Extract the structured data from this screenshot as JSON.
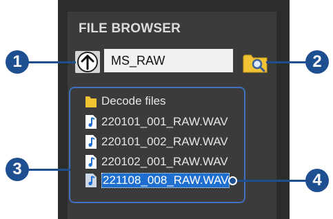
{
  "browser": {
    "title": "FILE BROWSER",
    "path_value": "MS_RAW",
    "up_icon": "up-arrow-icon",
    "browse_icon": "folder-search-icon",
    "items": [
      {
        "label": "Decode files",
        "type": "folder",
        "icon": "folder-icon"
      },
      {
        "label": "220101_001_RAW.WAV",
        "type": "audio",
        "icon": "audio-file-icon"
      },
      {
        "label": "220101_002_RAW.WAV",
        "type": "audio",
        "icon": "audio-file-icon"
      },
      {
        "label": "220102_001_RAW.WAV",
        "type": "audio",
        "icon": "audio-file-icon"
      },
      {
        "label": "221108_008_RAW.WAV",
        "type": "audio",
        "icon": "audio-file-icon",
        "selected": true
      }
    ]
  },
  "callouts": [
    "1",
    "2",
    "3",
    "4"
  ],
  "colors": {
    "panel": "#2c2c2c",
    "panel_inner": "#3b3b3b",
    "accent_blue": "#1e4f91",
    "selection": "#1f6fd1",
    "list_border": "#3f72c4",
    "folder": "#f1c232"
  }
}
